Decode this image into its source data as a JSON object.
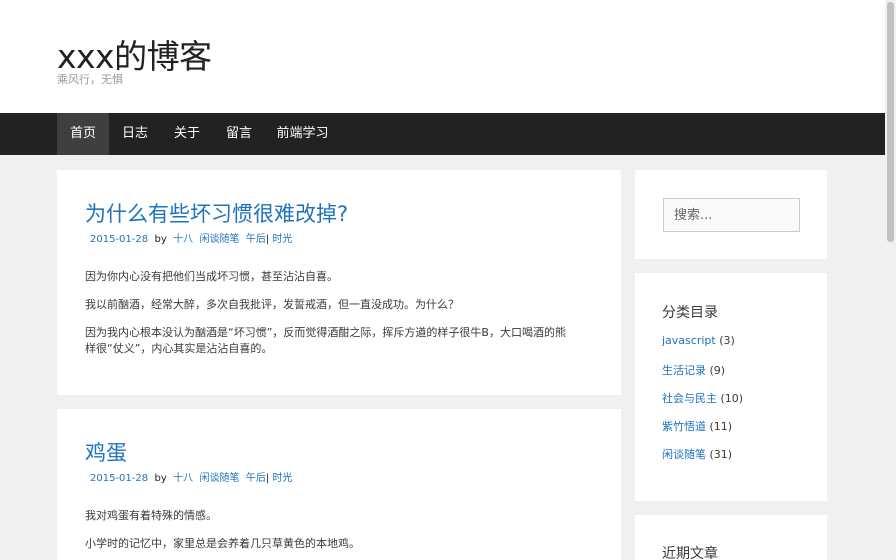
{
  "site": {
    "title": "xxx的博客",
    "description": "乘风行，无惧"
  },
  "nav": {
    "items": [
      {
        "label": "首页",
        "active": true
      },
      {
        "label": "日志"
      },
      {
        "label": "关于"
      },
      {
        "label": "留言"
      },
      {
        "label": "前端学习"
      }
    ]
  },
  "posts": [
    {
      "title": "为什么有些坏习惯很难改掉?",
      "date": "2015-01-28",
      "by": "by",
      "author": "十八",
      "category": "闲谈随笔",
      "tag1": "午后",
      "sep": "|",
      "tag2": "时光",
      "paragraphs": [
        "因为你内心没有把他们当成坏习惯，甚至沾沾自喜。",
        "我以前酗酒，经常大醉，多次自我批评，发誓戒酒，但一直没成功。为什么？",
        "因为我内心根本没认为酗酒是“坏习惯”，反而觉得酒酣之际，挥斥方遒的样子很牛B，大口喝酒的熊样很“仗义”，内心其实是沾沾自喜的。"
      ]
    },
    {
      "title": "鸡蛋",
      "date": "2015-01-28",
      "by": "by",
      "author": "十八",
      "category": "闲谈随笔",
      "tag1": "午后",
      "sep": "|",
      "tag2": "时光",
      "paragraphs": [
        "我对鸡蛋有着特殊的情感。",
        "小学时的记忆中，家里总是会养着几只草黄色的本地鸡。"
      ]
    }
  ],
  "sidebar": {
    "search": {
      "placeholder": "搜索..."
    },
    "categories": {
      "title": "分类目录",
      "items": [
        {
          "name": "javascript",
          "count": "(3)"
        },
        {
          "name": "生活记录",
          "count": "(9)"
        },
        {
          "name": "社会与民主",
          "count": "(10)"
        },
        {
          "name": "紫竹悟道",
          "count": "(11)"
        },
        {
          "name": "闲谈随笔",
          "count": "(31)"
        }
      ]
    },
    "recent": {
      "title": "近期文章"
    }
  },
  "colors": {
    "link": "#1e73be",
    "nav_bg": "#222222",
    "nav_active": "#3f3f3f",
    "page_bg": "#f0f0f0"
  }
}
